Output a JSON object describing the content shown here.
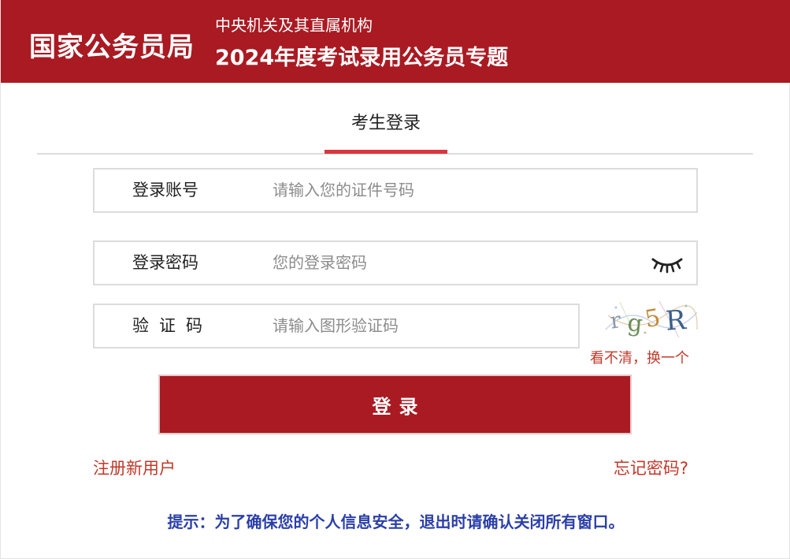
{
  "header": {
    "org_name": "国家公务员局",
    "subtitle_line1": "中央机关及其直属机构",
    "subtitle_line2": "2024年度考试录用公务员专题"
  },
  "tabs": [
    {
      "label": "考生登录",
      "active": true
    }
  ],
  "form": {
    "account": {
      "label": "登录账号",
      "placeholder": "请输入您的证件号码",
      "value": ""
    },
    "password": {
      "label": "登录密码",
      "placeholder": "您的登录密码",
      "value": "",
      "toggle_icon": "eye-closed-icon"
    },
    "captcha": {
      "label": "验证码",
      "placeholder": "请输入图形验证码",
      "value": "",
      "image_text": "rg5R",
      "refresh_label": "看不清，换一个"
    },
    "submit_label": "登录"
  },
  "links": {
    "register": "注册新用户",
    "forgot_password": "忘记密码?"
  },
  "tip": "提示：为了确保您的个人信息安全，退出时请确认关闭所有窗口。",
  "colors": {
    "brand": "#a91a22",
    "tab_accent": "#d9363e",
    "link": "#c0392b",
    "tip": "#2b3fa8"
  }
}
